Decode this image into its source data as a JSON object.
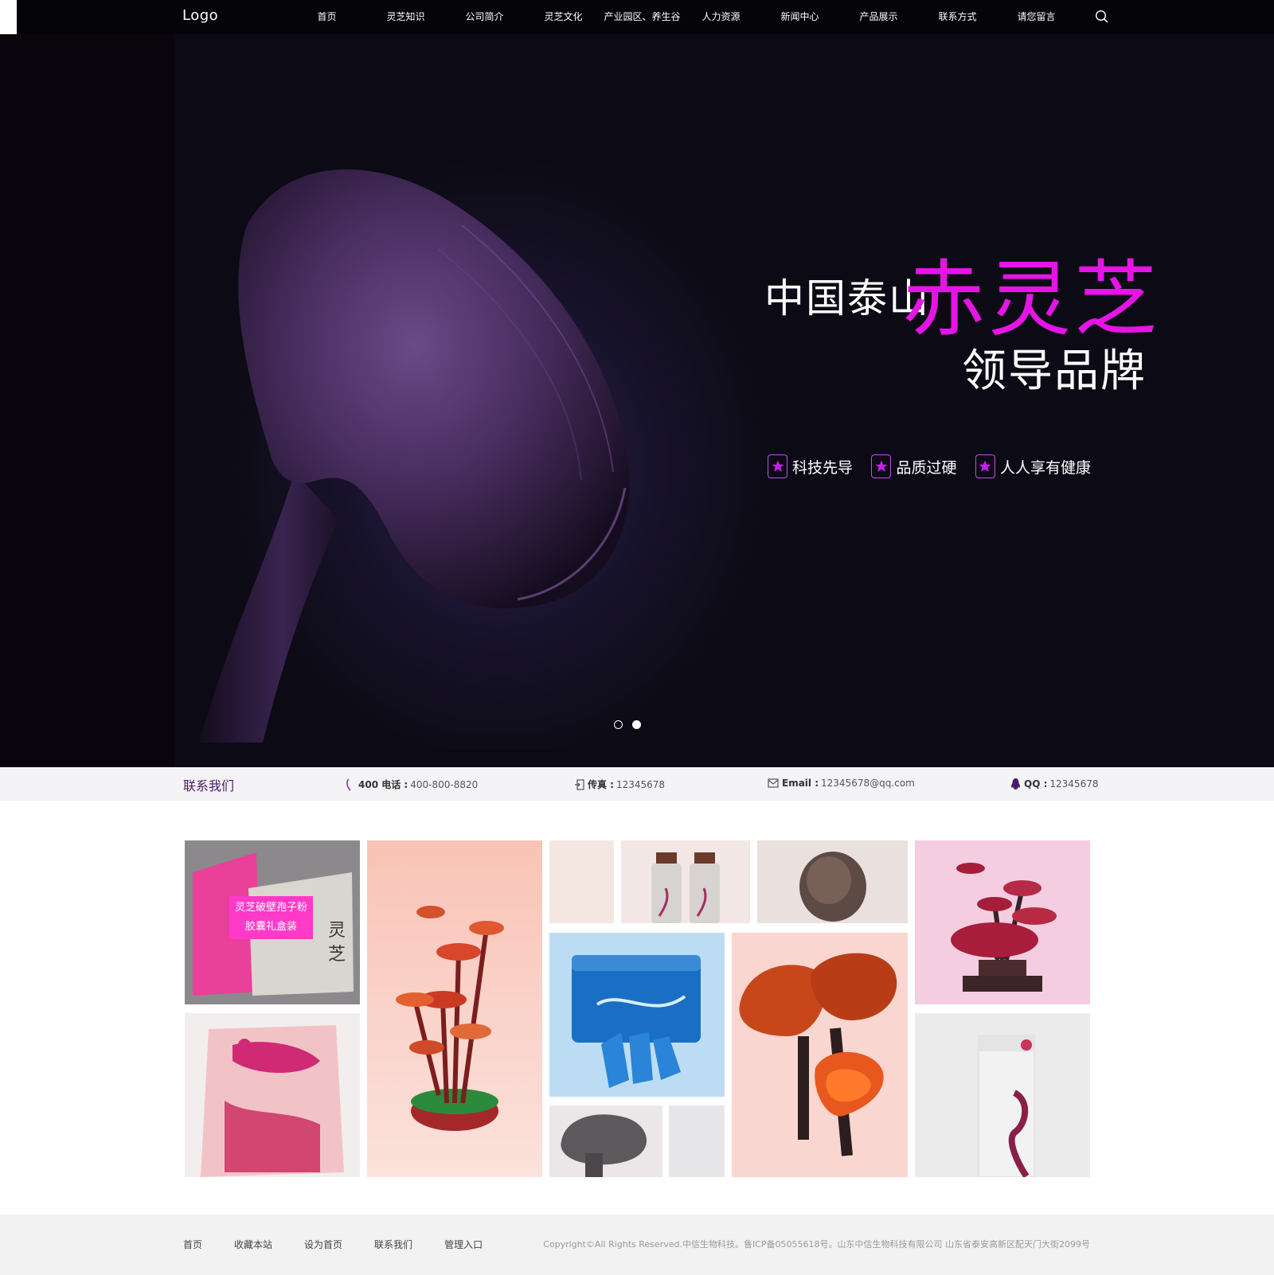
{
  "header": {
    "logo": "Logo",
    "nav": [
      "首页",
      "灵芝知识",
      "公司简介",
      "灵芝文化",
      "产业园区、养生谷",
      "人力资源",
      "新闻中心",
      "产品展示",
      "联系方式",
      "请您留言"
    ],
    "search_icon": "search-icon"
  },
  "hero": {
    "line1": "中国泰山",
    "line2": "赤灵芝",
    "line3": "领导品牌",
    "features": [
      "科技先导",
      "品质过硬",
      "人人享有健康"
    ],
    "feature_icon": "star-icon",
    "accent_color": "#e614e6",
    "slide_count": 2,
    "active_slide": 2
  },
  "contact": {
    "title": "联系我们",
    "phone_label": "400 电话 :",
    "phone_value": "400-800-8820",
    "fax_label": "传真 :",
    "fax_value": "12345678",
    "email_label": "Email :",
    "email_value": "12345678@qq.com",
    "qq_label": "QQ :",
    "qq_value": "12345678"
  },
  "products": {
    "featured_label_line1": "灵芝破壁孢子粉",
    "featured_label_line2": "胶囊礼盒装",
    "overlay_color": "#ff39c8"
  },
  "footer": {
    "links": [
      "首页",
      "收藏本站",
      "设为首页",
      "联系我们",
      "管理入口"
    ],
    "copyright": "Copyright©All Rights Reserved.中信生物科技。鲁ICP备05055618号。山东中信生物科技有限公司 山东省泰安高新区配天门大街2099号"
  }
}
